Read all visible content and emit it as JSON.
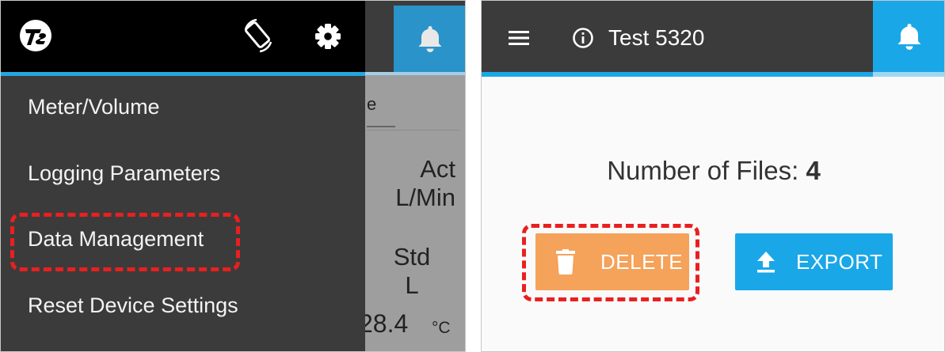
{
  "left_panel": {
    "background": {
      "tab_fragment": "e",
      "label_act": "Act",
      "label_act_unit": "L/Min",
      "label_std": "Std",
      "label_std_unit": "L",
      "reading_value": "28.4",
      "reading_unit": "°C"
    },
    "drawer": {
      "logo": "tsi-logo",
      "icons": [
        "screen-rotation-icon",
        "gear-icon"
      ],
      "menu_items": [
        {
          "label": "Meter/Volume"
        },
        {
          "label": "Logging Parameters"
        },
        {
          "label": "Data Management",
          "highlighted": true
        },
        {
          "label": "Reset Device Settings"
        }
      ]
    }
  },
  "right_panel": {
    "header": {
      "menu_icon": "hamburger-icon",
      "info_icon": "info-icon",
      "title": "Test 5320",
      "bell_icon": "bell-icon"
    },
    "files": {
      "label": "Number of Files:",
      "count": "4"
    },
    "buttons": {
      "delete_label": "DELETE",
      "export_label": "EXPORT"
    }
  },
  "colors": {
    "accent_blue": "#1aa7e8",
    "delete_orange": "#f5a25a",
    "highlight_red": "#e8201f",
    "drawer_dark": "#3b3b3b"
  }
}
